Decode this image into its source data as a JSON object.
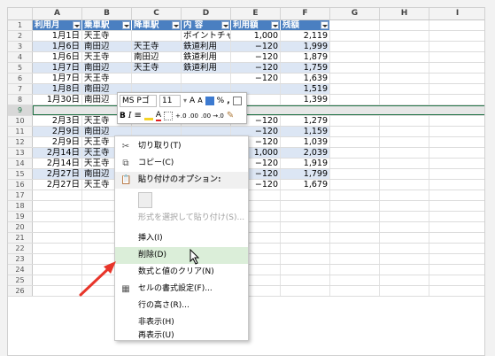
{
  "columns": [
    "A",
    "B",
    "C",
    "D",
    "E",
    "F",
    "G",
    "H",
    "I"
  ],
  "table": {
    "headers": [
      "利用月",
      "乗車駅",
      "降車駅",
      "内 容",
      "利用額",
      "残額"
    ],
    "rows": [
      {
        "n": "2",
        "a": "1月1日",
        "b": "天王寺",
        "c": "",
        "d": "ポイントチャ",
        "e": "1,000",
        "f": "2,119",
        "band": false
      },
      {
        "n": "3",
        "a": "1月6日",
        "b": "南田辺",
        "c": "天王寺",
        "d": "鉄道利用",
        "e": "−120",
        "f": "1,999",
        "band": true
      },
      {
        "n": "4",
        "a": "1月6日",
        "b": "天王寺",
        "c": "南田辺",
        "d": "鉄道利用",
        "e": "−120",
        "f": "1,879",
        "band": false
      },
      {
        "n": "5",
        "a": "1月7日",
        "b": "南田辺",
        "c": "天王寺",
        "d": "鉄道利用",
        "e": "−120",
        "f": "1,759",
        "band": true
      },
      {
        "n": "6",
        "a": "1月7日",
        "b": "天王寺",
        "c": "",
        "d": "",
        "e": "−120",
        "f": "1,639",
        "band": false
      },
      {
        "n": "7",
        "a": "1月8日",
        "b": "南田辺",
        "c": "",
        "d": "",
        "e": "",
        "f": "1,519",
        "band": true
      },
      {
        "n": "8",
        "a": "1月30日",
        "b": "南田辺",
        "c": "",
        "d": "",
        "e": "",
        "f": "1,399",
        "band": false
      },
      {
        "n": "9",
        "a": "",
        "b": "",
        "c": "",
        "d": "",
        "e": "",
        "f": "",
        "band": false,
        "selected": true
      },
      {
        "n": "10",
        "a": "2月3日",
        "b": "天王寺",
        "c": "",
        "d": "",
        "e": "−120",
        "f": "1,279",
        "band": false
      },
      {
        "n": "11",
        "a": "2月9日",
        "b": "南田辺",
        "c": "",
        "d": "",
        "e": "−120",
        "f": "1,159",
        "band": true
      },
      {
        "n": "12",
        "a": "2月9日",
        "b": "天王寺",
        "c": "",
        "d": "",
        "e": "−120",
        "f": "1,039",
        "band": false
      },
      {
        "n": "13",
        "a": "2月14日",
        "b": "天王寺",
        "c": "",
        "d": "",
        "e": "1,000",
        "f": "2,039",
        "band": true
      },
      {
        "n": "14",
        "a": "2月14日",
        "b": "天王寺",
        "c": "",
        "d": "",
        "e": "−120",
        "f": "1,919",
        "band": false
      },
      {
        "n": "15",
        "a": "2月27日",
        "b": "南田辺",
        "c": "",
        "d": "",
        "e": "−120",
        "f": "1,799",
        "band": true
      },
      {
        "n": "16",
        "a": "2月27日",
        "b": "天王寺",
        "c": "",
        "d": "",
        "e": "−120",
        "f": "1,679",
        "band": false
      }
    ],
    "empty_rows": [
      "17",
      "18",
      "19",
      "20",
      "21",
      "22",
      "23",
      "24",
      "25",
      "26"
    ]
  },
  "minibar": {
    "font": "MS Pゴ",
    "size": "11",
    "grow": "A",
    "shrink": "A",
    "percent": "%",
    "comma": ",",
    "bold": "B",
    "italic": "I",
    "font_color": "A",
    "inc_decimal": "+.0 .00",
    "dec_decimal": ".00 →.0"
  },
  "context_menu": {
    "cut": "切り取り(T)",
    "copy": "コピー(C)",
    "paste_options": "貼り付けのオプション:",
    "paste_special": "形式を選択して貼り付け(S)...",
    "insert": "挿入(I)",
    "delete": "削除(D)",
    "clear": "数式と値のクリア(N)",
    "format_cells": "セルの書式設定(F)...",
    "row_height": "行の高さ(R)...",
    "hide": "非表示(H)",
    "unhide": "再表示(U)"
  },
  "colors": {
    "header_blue": "#4a7fc1",
    "band_blue": "#dce6f4",
    "selection_green": "#217346",
    "highlight": "#dbeed9",
    "arrow_red": "#e8352a"
  }
}
